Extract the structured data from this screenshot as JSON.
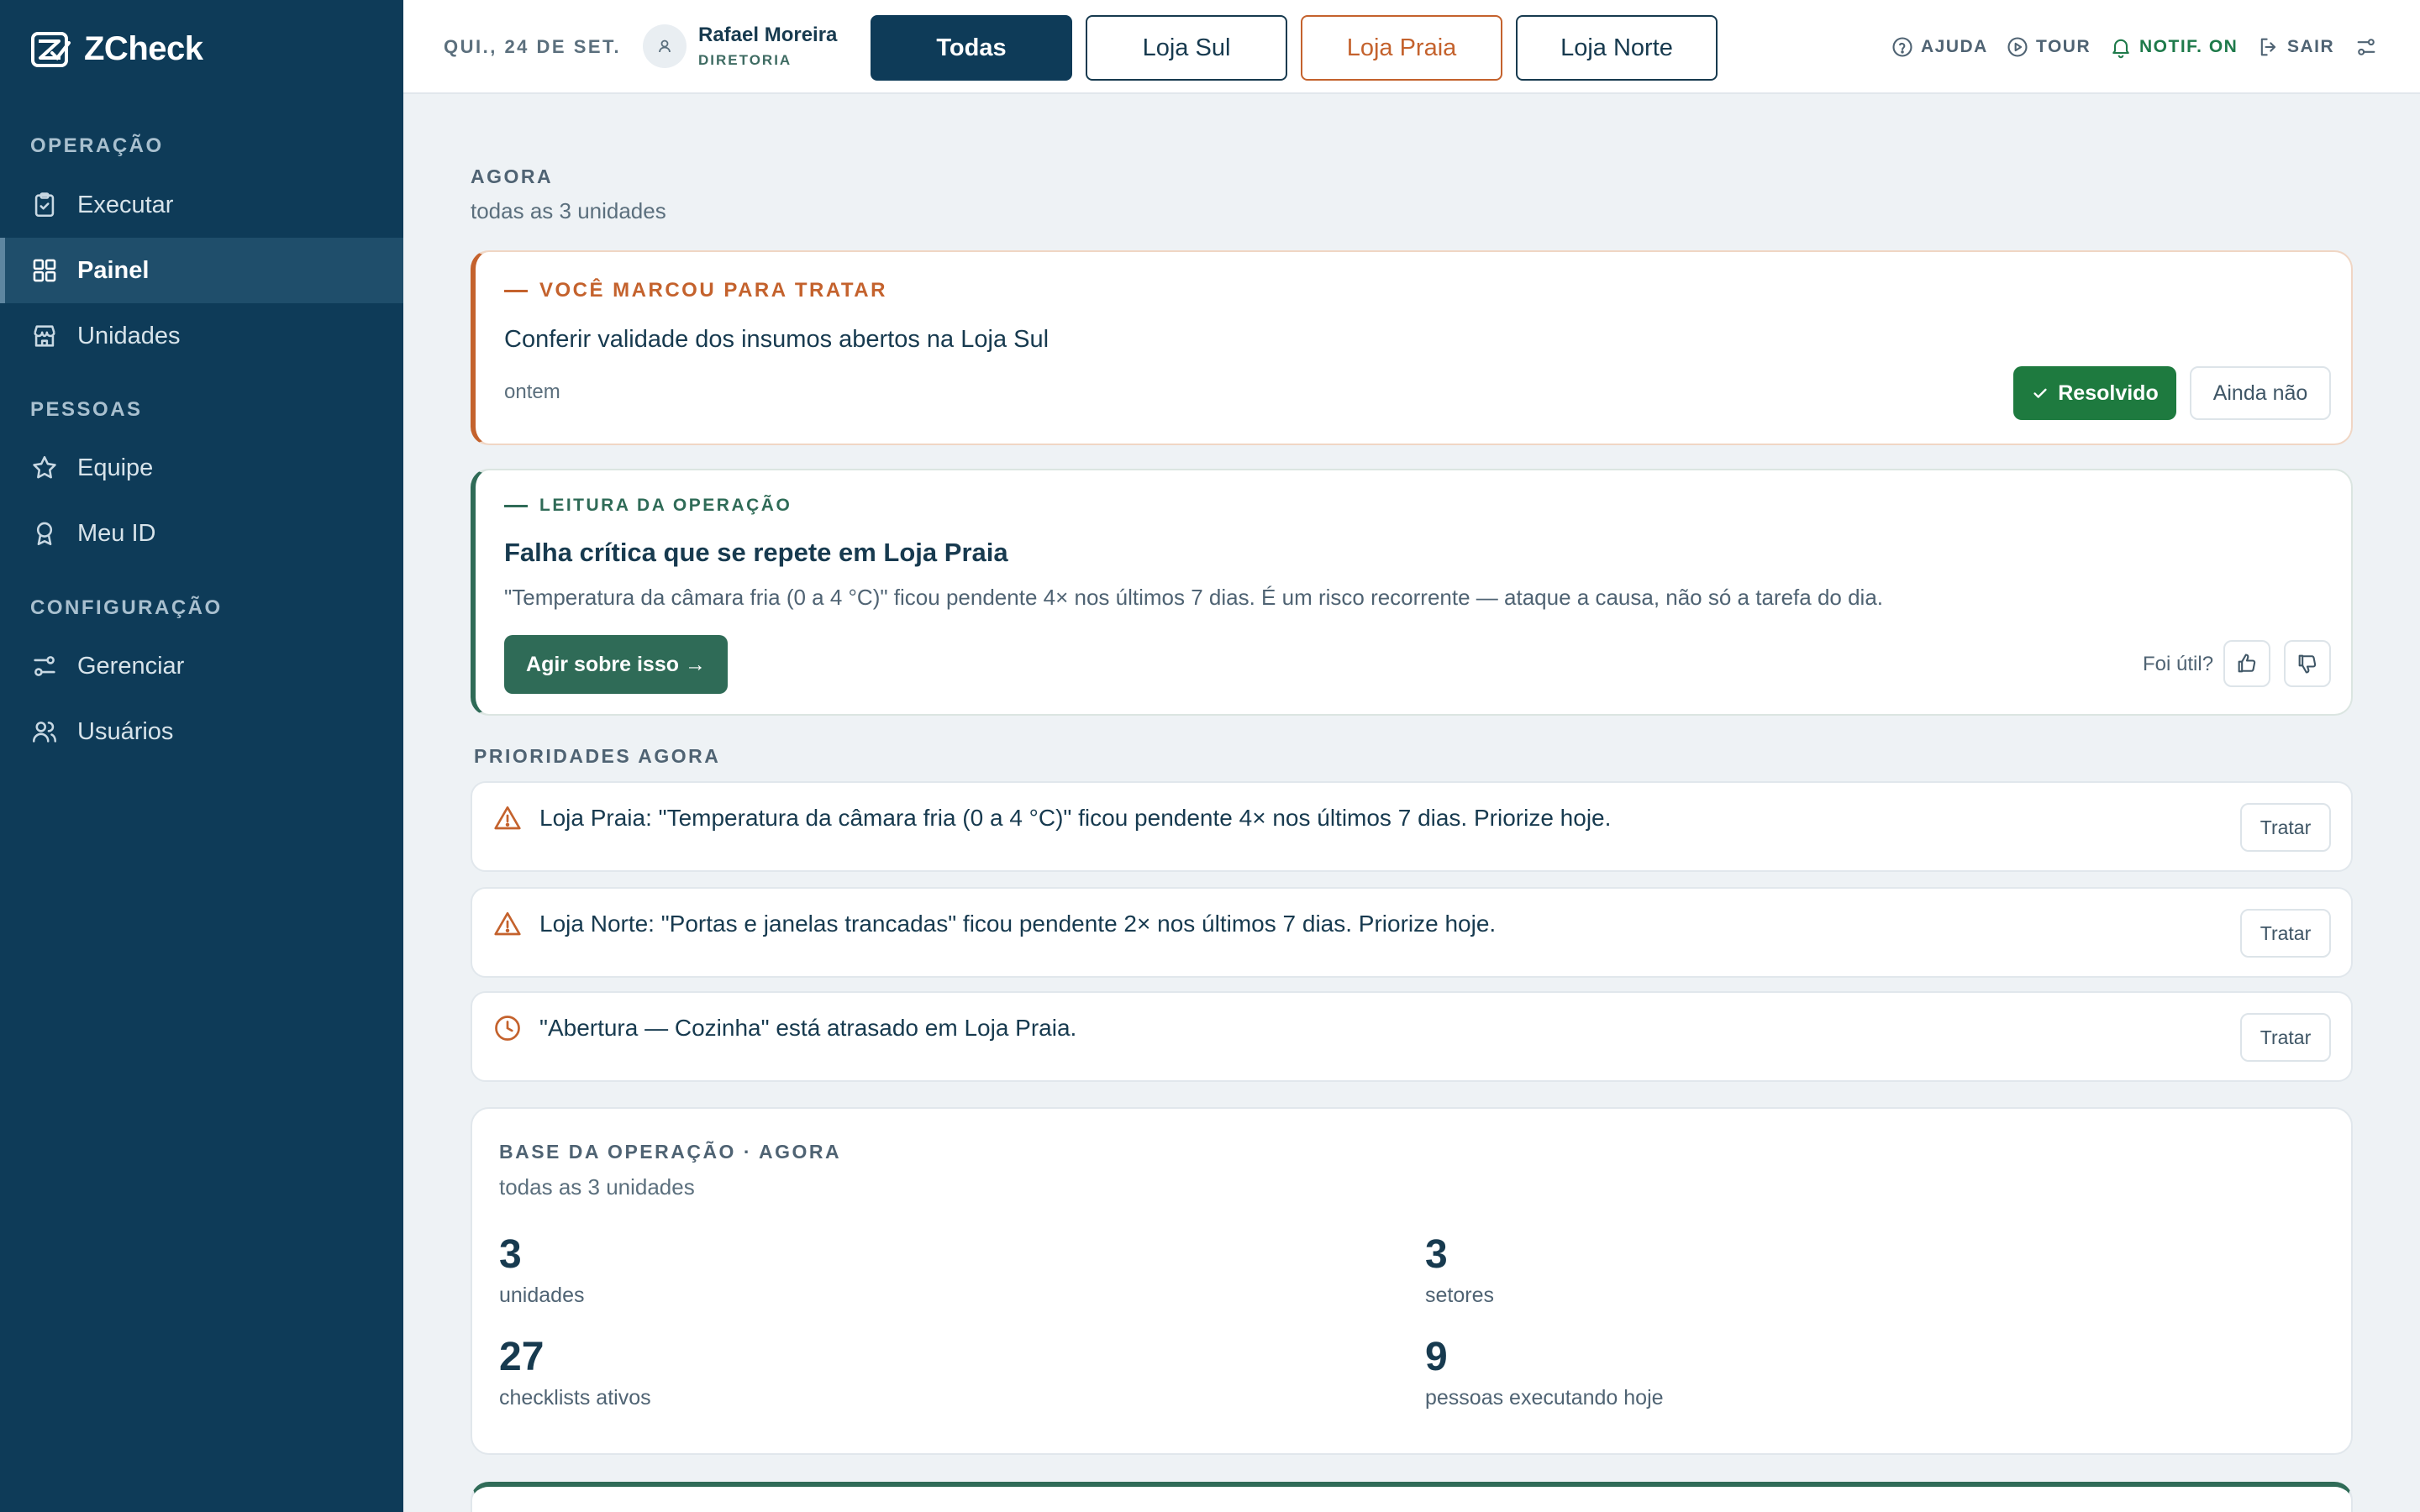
{
  "app": {
    "name": "ZCheck"
  },
  "sidebar": {
    "sections": [
      {
        "label": "OPERAÇÃO",
        "items": [
          {
            "label": "Executar",
            "icon": "clipboard-check-icon"
          },
          {
            "label": "Painel",
            "icon": "grid-icon",
            "active": true
          },
          {
            "label": "Unidades",
            "icon": "store-icon"
          }
        ]
      },
      {
        "label": "PESSOAS",
        "items": [
          {
            "label": "Equipe",
            "icon": "star-icon"
          },
          {
            "label": "Meu ID",
            "icon": "badge-icon"
          }
        ]
      },
      {
        "label": "CONFIGURAÇÃO",
        "items": [
          {
            "label": "Gerenciar",
            "icon": "sliders-icon"
          },
          {
            "label": "Usuários",
            "icon": "users-icon"
          }
        ]
      }
    ]
  },
  "topbar": {
    "date": "QUI., 24 DE SET.",
    "user": {
      "name": "Rafael Moreira",
      "role": "DIRETORIA"
    },
    "stores": [
      {
        "label": "Todas",
        "state": "active"
      },
      {
        "label": "Loja Sul",
        "state": "normal"
      },
      {
        "label": "Loja Praia",
        "state": "warning"
      },
      {
        "label": "Loja Norte",
        "state": "normal"
      }
    ],
    "actions": {
      "help": "AJUDA",
      "tour": "TOUR",
      "notif": "NOTIF. ON",
      "logout": "SAIR"
    }
  },
  "now": {
    "title": "AGORA",
    "subtitle": "todas as 3 unidades"
  },
  "flagged": {
    "kicker": "VOCÊ MARCOU PARA TRATAR",
    "text": "Conferir validade dos insumos abertos na Loja Sul",
    "when": "ontem",
    "resolved_label": "Resolvido",
    "not_yet_label": "Ainda não"
  },
  "insight": {
    "kicker": "LEITURA DA OPERAÇÃO",
    "title": "Falha crítica que se repete em Loja Praia",
    "body": "\"Temperatura da câmara fria (0 a 4 °C)\" ficou pendente 4× nos últimos 7 dias. É um risco recorrente — ataque a causa, não só a tarefa do dia.",
    "action_label": "Agir sobre isso →",
    "feedback_label": "Foi útil?"
  },
  "priorities": {
    "title": "PRIORIDADES AGORA",
    "button_label": "Tratar",
    "items": [
      {
        "icon": "warning-icon",
        "text": "Loja Praia: \"Temperatura da câmara fria (0 a 4 °C)\" ficou pendente 4× nos últimos 7 dias. Priorize hoje."
      },
      {
        "icon": "warning-icon",
        "text": "Loja Norte: \"Portas e janelas trancadas\" ficou pendente 2× nos últimos 7 dias. Priorize hoje."
      },
      {
        "icon": "clock-icon",
        "text": "\"Abertura — Cozinha\" está atrasado em Loja Praia."
      }
    ]
  },
  "base": {
    "title": "BASE DA OPERAÇÃO · AGORA",
    "subtitle": "todas as 3 unidades",
    "stats": [
      {
        "value": "3",
        "label": "unidades"
      },
      {
        "value": "3",
        "label": "setores"
      },
      {
        "value": "27",
        "label": "checklists ativos"
      },
      {
        "value": "9",
        "label": "pessoas executando hoje"
      }
    ]
  },
  "colors": {
    "sidebar": "#0e3b58",
    "accent_orange": "#c4622d",
    "accent_green": "#2f6b57",
    "success": "#1e7a3f"
  }
}
